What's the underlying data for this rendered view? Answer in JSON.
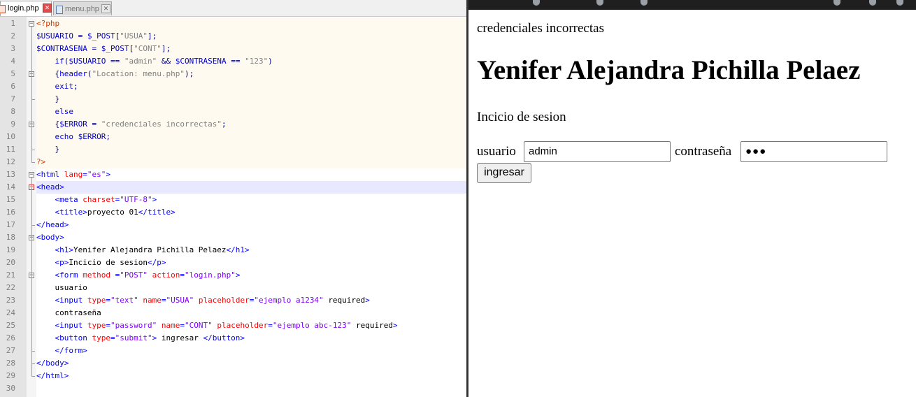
{
  "editor": {
    "tabs": [
      {
        "label": "login.php",
        "active": true
      },
      {
        "label": "menu.php",
        "active": false
      }
    ],
    "tab_close_glyph": "✕",
    "line_numbers": [
      "1",
      "2",
      "3",
      "4",
      "5",
      "6",
      "7",
      "8",
      "9",
      "10",
      "11",
      "12",
      "13",
      "14",
      "15",
      "16",
      "17",
      "18",
      "19",
      "20",
      "21",
      "22",
      "23",
      "24",
      "25",
      "26",
      "27",
      "28",
      "29",
      "30"
    ],
    "current_line": 14,
    "lines": [
      [
        [
          "t-php",
          "<?php"
        ]
      ],
      [
        [
          "t-var",
          "$USUARIO"
        ],
        [
          "t-op",
          " = "
        ],
        [
          "t-var",
          "$_POST"
        ],
        [
          "t-op",
          "["
        ],
        [
          "t-str",
          "\"USUA\""
        ],
        [
          "t-op",
          "];"
        ]
      ],
      [
        [
          "t-var",
          "$CONTRASENA"
        ],
        [
          "t-op",
          " = "
        ],
        [
          "t-var",
          "$_POST"
        ],
        [
          "t-op",
          "["
        ],
        [
          "t-str",
          "\"CONT\""
        ],
        [
          "t-op",
          "];"
        ]
      ],
      [
        [
          "t-plain",
          "    "
        ],
        [
          "t-kw",
          "if"
        ],
        [
          "t-op",
          "("
        ],
        [
          "t-var",
          "$USUARIO"
        ],
        [
          "t-op",
          " == "
        ],
        [
          "t-str",
          "\"admin\""
        ],
        [
          "t-op",
          " && "
        ],
        [
          "t-var",
          "$CONTRASENA"
        ],
        [
          "t-op",
          " == "
        ],
        [
          "t-str",
          "\"123\""
        ],
        [
          "t-op",
          ")"
        ]
      ],
      [
        [
          "t-plain",
          "    "
        ],
        [
          "t-op",
          "{"
        ],
        [
          "t-kw",
          "header"
        ],
        [
          "t-op",
          "("
        ],
        [
          "t-str",
          "\"Location: menu.php\""
        ],
        [
          "t-op",
          ");"
        ]
      ],
      [
        [
          "t-plain",
          "    "
        ],
        [
          "t-kw",
          "exit"
        ],
        [
          "t-op",
          ";"
        ]
      ],
      [
        [
          "t-plain",
          "    "
        ],
        [
          "t-op",
          "}"
        ]
      ],
      [
        [
          "t-plain",
          "    "
        ],
        [
          "t-kw",
          "else"
        ]
      ],
      [
        [
          "t-plain",
          "    "
        ],
        [
          "t-op",
          "{"
        ],
        [
          "t-var",
          "$ERROR"
        ],
        [
          "t-op",
          " = "
        ],
        [
          "t-str",
          "\"credenciales incorrectas\""
        ],
        [
          "t-op",
          ";"
        ]
      ],
      [
        [
          "t-plain",
          "    "
        ],
        [
          "t-kw",
          "echo"
        ],
        [
          "t-plain",
          " "
        ],
        [
          "t-var",
          "$ERROR"
        ],
        [
          "t-op",
          ";"
        ]
      ],
      [
        [
          "t-plain",
          "    "
        ],
        [
          "t-op",
          "}"
        ]
      ],
      [
        [
          "t-php",
          "?>"
        ]
      ],
      [
        [
          "t-tag",
          "<html "
        ],
        [
          "t-attr",
          "lang"
        ],
        [
          "t-tag",
          "="
        ],
        [
          "t-val",
          "\"es\""
        ],
        [
          "t-tag",
          ">"
        ]
      ],
      [
        [
          "t-tag",
          "<head>"
        ]
      ],
      [
        [
          "t-plain",
          "    "
        ],
        [
          "t-tag",
          "<meta "
        ],
        [
          "t-attr",
          "charset"
        ],
        [
          "t-tag",
          "="
        ],
        [
          "t-val",
          "\"UTF-8\""
        ],
        [
          "t-tag",
          ">"
        ]
      ],
      [
        [
          "t-plain",
          "    "
        ],
        [
          "t-tag",
          "<title>"
        ],
        [
          "t-txt",
          "proyecto 01"
        ],
        [
          "t-tag",
          "</title>"
        ]
      ],
      [
        [
          "t-tag",
          "</head>"
        ]
      ],
      [
        [
          "t-tag",
          "<body>"
        ]
      ],
      [
        [
          "t-plain",
          "    "
        ],
        [
          "t-tag",
          "<h1>"
        ],
        [
          "t-txt",
          "Yenifer Alejandra Pichilla Pelaez"
        ],
        [
          "t-tag",
          "</h1>"
        ]
      ],
      [
        [
          "t-plain",
          "    "
        ],
        [
          "t-tag",
          "<p>"
        ],
        [
          "t-txt",
          "Incicio de sesion"
        ],
        [
          "t-tag",
          "</p>"
        ]
      ],
      [
        [
          "t-plain",
          "    "
        ],
        [
          "t-tag",
          "<form "
        ],
        [
          "t-attr",
          "method"
        ],
        [
          "t-tag",
          " ="
        ],
        [
          "t-val",
          "\"POST\""
        ],
        [
          "t-tag",
          " "
        ],
        [
          "t-attr",
          "action"
        ],
        [
          "t-tag",
          "="
        ],
        [
          "t-val",
          "\"login.php\""
        ],
        [
          "t-tag",
          ">"
        ]
      ],
      [
        [
          "t-plain",
          "    "
        ],
        [
          "t-txt",
          "usuario"
        ]
      ],
      [
        [
          "t-plain",
          "    "
        ],
        [
          "t-tag",
          "<input "
        ],
        [
          "t-attr",
          "type"
        ],
        [
          "t-tag",
          "="
        ],
        [
          "t-val",
          "\"text\""
        ],
        [
          "t-tag",
          " "
        ],
        [
          "t-attr",
          "name"
        ],
        [
          "t-tag",
          "="
        ],
        [
          "t-val",
          "\"USUA\""
        ],
        [
          "t-tag",
          " "
        ],
        [
          "t-attr",
          "placeholder"
        ],
        [
          "t-tag",
          "="
        ],
        [
          "t-val",
          "\"ejemplo a1234\""
        ],
        [
          "t-tag",
          " "
        ],
        [
          "t-txt",
          "required"
        ],
        [
          "t-tag",
          ">"
        ]
      ],
      [
        [
          "t-plain",
          "    "
        ],
        [
          "t-txt",
          "contraseña"
        ]
      ],
      [
        [
          "t-plain",
          "    "
        ],
        [
          "t-tag",
          "<input "
        ],
        [
          "t-attr",
          "type"
        ],
        [
          "t-tag",
          "="
        ],
        [
          "t-val",
          "\"password\""
        ],
        [
          "t-tag",
          " "
        ],
        [
          "t-attr",
          "name"
        ],
        [
          "t-tag",
          "="
        ],
        [
          "t-val",
          "\"CONT\""
        ],
        [
          "t-tag",
          " "
        ],
        [
          "t-attr",
          "placeholder"
        ],
        [
          "t-tag",
          "="
        ],
        [
          "t-val",
          "\"ejemplo abc-123\""
        ],
        [
          "t-tag",
          " "
        ],
        [
          "t-txt",
          "required"
        ],
        [
          "t-tag",
          ">"
        ]
      ],
      [
        [
          "t-plain",
          "    "
        ],
        [
          "t-tag",
          "<button "
        ],
        [
          "t-attr",
          "type"
        ],
        [
          "t-tag",
          "="
        ],
        [
          "t-val",
          "\"submit\""
        ],
        [
          "t-tag",
          "> "
        ],
        [
          "t-txt",
          "ingresar"
        ],
        [
          "t-tag",
          " </button>"
        ]
      ],
      [
        [
          "t-plain",
          "    "
        ],
        [
          "t-tag",
          "</form>"
        ]
      ],
      [
        [
          "t-tag",
          "</body>"
        ]
      ],
      [
        [
          "t-tag",
          "</html>"
        ]
      ],
      []
    ]
  },
  "browser": {
    "error_text": "credenciales incorrectas",
    "heading": "Yenifer Alejandra Pichilla Pelaez",
    "subtitle": "Incicio de sesion",
    "form": {
      "user_label": "usuario",
      "user_value": "admin",
      "user_placeholder": "ejemplo a1234",
      "pass_label": "contraseña",
      "pass_value": "●●●",
      "pass_placeholder": "ejemplo abc-123",
      "submit_label": "ingresar"
    }
  },
  "colors": {
    "php_tag": "#d13a00",
    "variable": "#0000cc",
    "keyword": "#0000ff",
    "string": "#808080",
    "html_tag": "#0000ff",
    "attribute": "#ff0000",
    "attribute_value": "#8000ff"
  }
}
